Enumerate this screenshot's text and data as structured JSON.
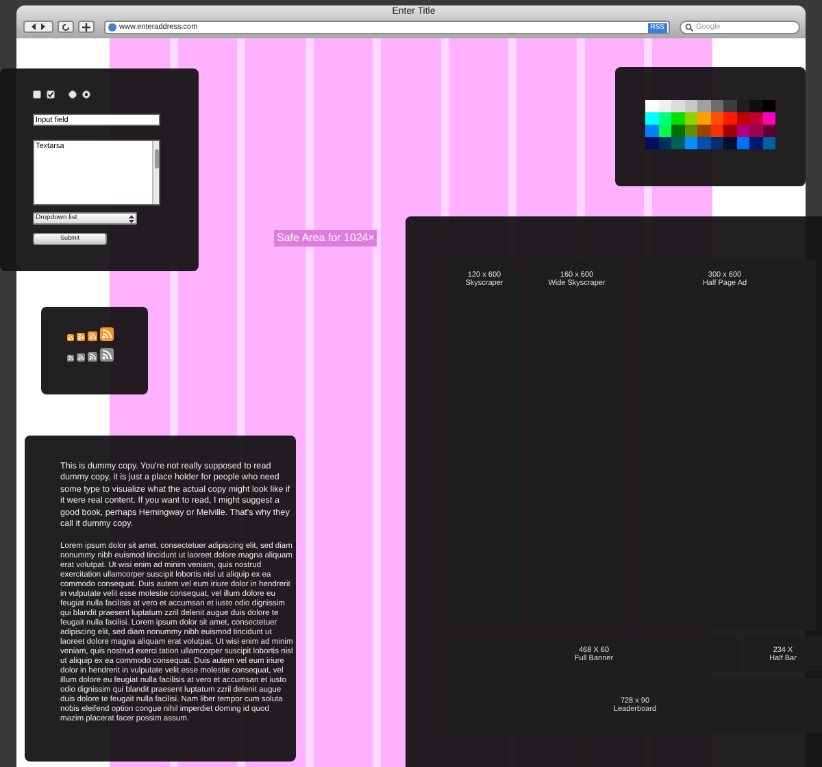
{
  "window": {
    "title": "Enter Title"
  },
  "toolbar": {
    "address": "www.enteraddress.com",
    "rss_badge": "RSS",
    "search": {
      "placeholder": "Google"
    }
  },
  "page": {
    "guide_label": "Safe Area for 1024×"
  },
  "form_panel": {
    "controls": [
      {
        "kind": "checkbox",
        "checked": false
      },
      {
        "kind": "checkbox",
        "checked": true
      },
      {
        "kind": "radio",
        "checked": false
      },
      {
        "kind": "radio",
        "checked": true
      }
    ],
    "input": {
      "value": "Input field"
    },
    "textarea": {
      "value": "Textarsa"
    },
    "dropdown": {
      "value": "Dropdown list"
    },
    "button": "Submit"
  },
  "palette": {
    "swatches": [
      [
        {
          "color": "#ffffff"
        },
        {
          "color": "#f0f0f0"
        },
        {
          "color": "#dcdcdc"
        },
        {
          "color": "#c8c8c8"
        },
        {
          "color": "#a0a0a0"
        },
        {
          "color": "#6e6e6e"
        },
        {
          "color": "#3c3c3c"
        },
        {
          "color": "#1e1e1e"
        },
        {
          "color": "#0f0f0f"
        },
        {
          "color": "#000000"
        }
      ],
      [
        {
          "color": "#00ffff"
        },
        {
          "color": "#00ff80"
        },
        {
          "color": "#00e000"
        },
        {
          "color": "#90d000"
        },
        {
          "color": "#ffa000"
        },
        {
          "color": "#ff5000"
        },
        {
          "color": "#ff1a00"
        },
        {
          "color": "#c00000"
        },
        {
          "color": "#c00030"
        },
        {
          "color": "#ff00c0"
        }
      ],
      [
        {
          "color": "#0080ff"
        },
        {
          "color": "#00ff50"
        },
        {
          "color": "#007000"
        },
        {
          "color": "#609000"
        },
        {
          "color": "#a04000"
        },
        {
          "color": "#ff3000"
        },
        {
          "color": "#a00000"
        },
        {
          "color": "#b00080"
        },
        {
          "color": "#a00050"
        },
        {
          "color": "#600030"
        }
      ],
      [
        {
          "color": "#001060"
        },
        {
          "color": "#003060"
        },
        {
          "color": "#006060"
        },
        {
          "color": "#0090ff"
        },
        {
          "color": "#0050b0"
        },
        {
          "color": "#003070"
        },
        {
          "color": "#001030"
        },
        {
          "color": "#0070ff"
        },
        {
          "color": "#001870"
        },
        {
          "color": "#0060a0"
        }
      ]
    ]
  },
  "rss_panel": {
    "rows": [
      {
        "color": "#f7931e"
      },
      {
        "color": "#8c8c8c"
      }
    ]
  },
  "text_panel": {
    "paragraphs": [
      "This is dummy copy. You're not really supposed to read dummy copy, it is just a place holder for people who need some type to visualize what the actual copy might look like if it were real content. If you want to read, I might suggest a good book, perhaps Hemingway or Melville. That's why they call it dummy copy.",
      "Lorem ipsum dolor sit amet, consectetuer adipiscing elit, sed diam nonummy nibh euismod tincidunt ut laoreet dolore magna aliquam erat volutpat. Ut wisi enim ad minim veniam, quis nostrud exercitation ullamcorper suscipit lobortis nisl ut aliquip ex ea commodo consequat. Duis autem vel eum iriure dolor in hendrerit in vulputate velit esse molestie consequat, vel illum dolore eu feugiat nulla facilisis at vero et accumsan et iusto odio dignissim qui blandit praesent luptatum zzril delenit augue duis dolore te feugait nulla facilisi. Lorem ipsum dolor sit amet, consectetuer adipiscing elit, sed diam nonummy nibh euismod tincidunt ut laoreet dolore magna aliquam erat volutpat. Ut wisi enim ad minim veniam, quis nostrud exerci tation ullamcorper suscipit lobortis nisl ut aliquip ex ea commodo consequat. Duis autem vel eum iriure dolor in hendrerit in vulputate velit esse molestie consequat, vel illum dolore eu feugiat nulla facilisis at vero et accumsan et iusto odio dignissim qui blandit praesent luptatum zzril delenit augue duis dolore te feugait nulla facilisi. Nam liber tempor cum soluta nobis eleifend option congue nihil imperdiet doming id quod mazim placerat facer possim assum."
    ]
  },
  "ad_panel": {
    "ads": [
      {
        "size": "120 x 600",
        "name": "Skyscraper"
      },
      {
        "size": "160 x 600",
        "name": "Wide Skyscraper"
      },
      {
        "size": "300 x 600",
        "name": "Half Page Ad"
      },
      {
        "size": "468 X 60",
        "name": "Full Banner"
      },
      {
        "size": "234 X",
        "name": "Half Bar"
      },
      {
        "size": "728 x 90",
        "name": "Leaderboard"
      }
    ]
  }
}
